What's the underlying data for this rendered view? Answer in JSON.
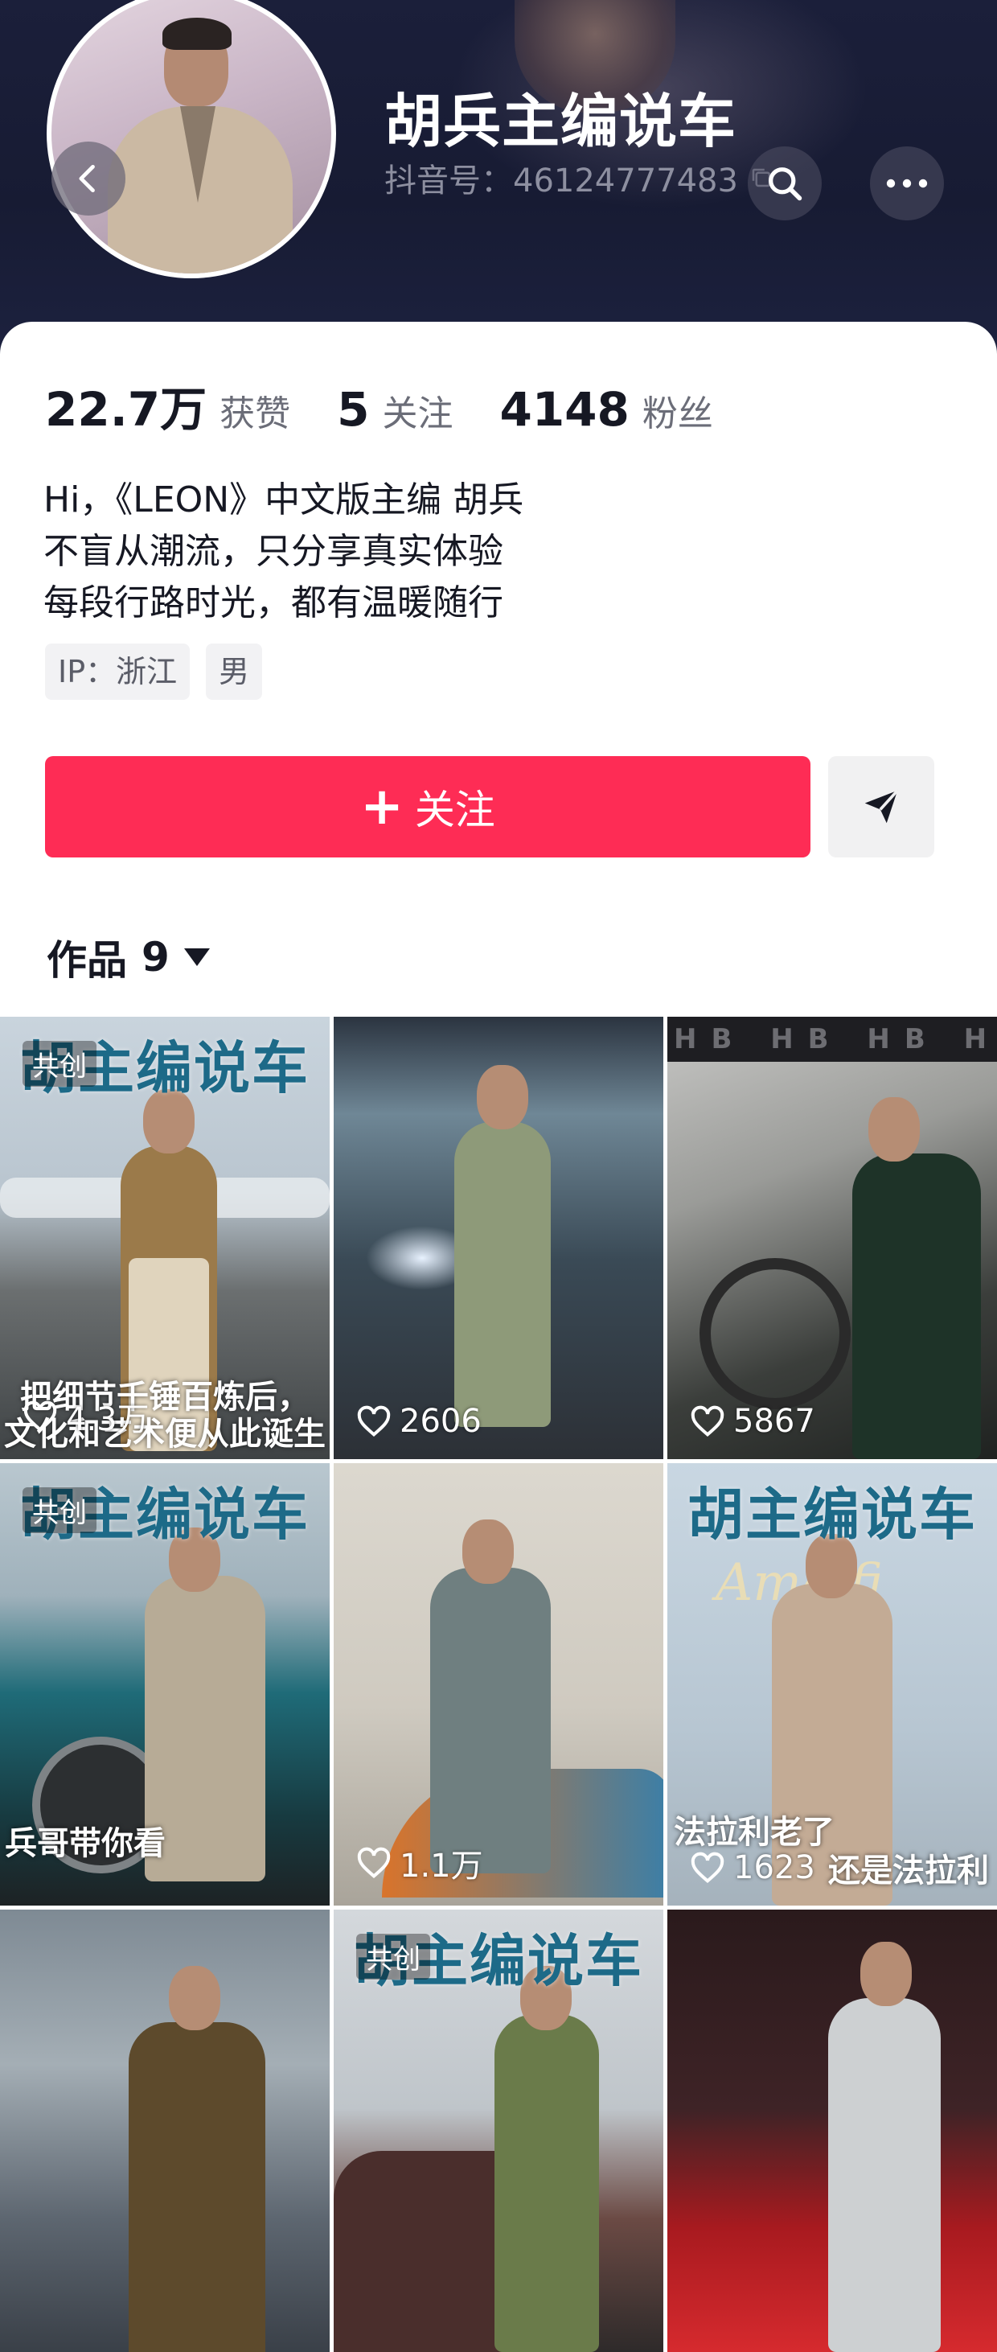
{
  "header": {
    "name": "胡兵主编说车",
    "douyin_id": "抖音号：46124777483"
  },
  "stats": [
    {
      "num": "22.7万",
      "label": "获赞"
    },
    {
      "num": "5",
      "label": "关注"
    },
    {
      "num": "4148",
      "label": "粉丝"
    }
  ],
  "bio": [
    "Hi，《LEON》中文版主编 胡兵",
    "不盲从潮流，只分享真实体验",
    "每段行路时光，都有温暖随行"
  ],
  "tags": [
    "IP：浙江",
    "男"
  ],
  "follow_label": "关注",
  "works": {
    "label": "作品",
    "count": "9"
  },
  "videos": [
    {
      "banner": "胡主编说车",
      "cocreate": "共创",
      "caption1": "把细节千锤百炼后，",
      "caption2": "文化和艺术便从此诞生",
      "likes": "4.3万"
    },
    {
      "banner": "",
      "cocreate": "",
      "caption1": "",
      "caption2": "",
      "likes": "2606"
    },
    {
      "banner": "",
      "cocreate": "",
      "caption1": "",
      "caption2": "",
      "likes": "5867",
      "strip": "HB HB HB HB HB HB"
    },
    {
      "banner": "胡主编说车",
      "cocreate": "共创",
      "caption1": "兵哥带你看",
      "caption2": "",
      "likes": ""
    },
    {
      "banner": "",
      "cocreate": "",
      "caption1": "",
      "caption2": "",
      "likes": "1.1万"
    },
    {
      "banner": "胡主编说车",
      "cocreate": "",
      "caption1": "法拉利老了",
      "caption2": "还是法拉利",
      "likes": "1623",
      "ferrari": "Amalfi"
    },
    {
      "banner": "",
      "cocreate": "",
      "caption1": "",
      "caption2": "",
      "likes": ""
    },
    {
      "banner": "胡主编说车",
      "cocreate": "共创",
      "caption1": "",
      "caption2": "",
      "likes": ""
    },
    {
      "banner": "",
      "cocreate": "",
      "caption1": "",
      "caption2": "",
      "likes": ""
    }
  ],
  "colors": {
    "accent": "#fe2c55",
    "header_bg": "#1b1f3a",
    "banner_text": "#1d6a88"
  }
}
